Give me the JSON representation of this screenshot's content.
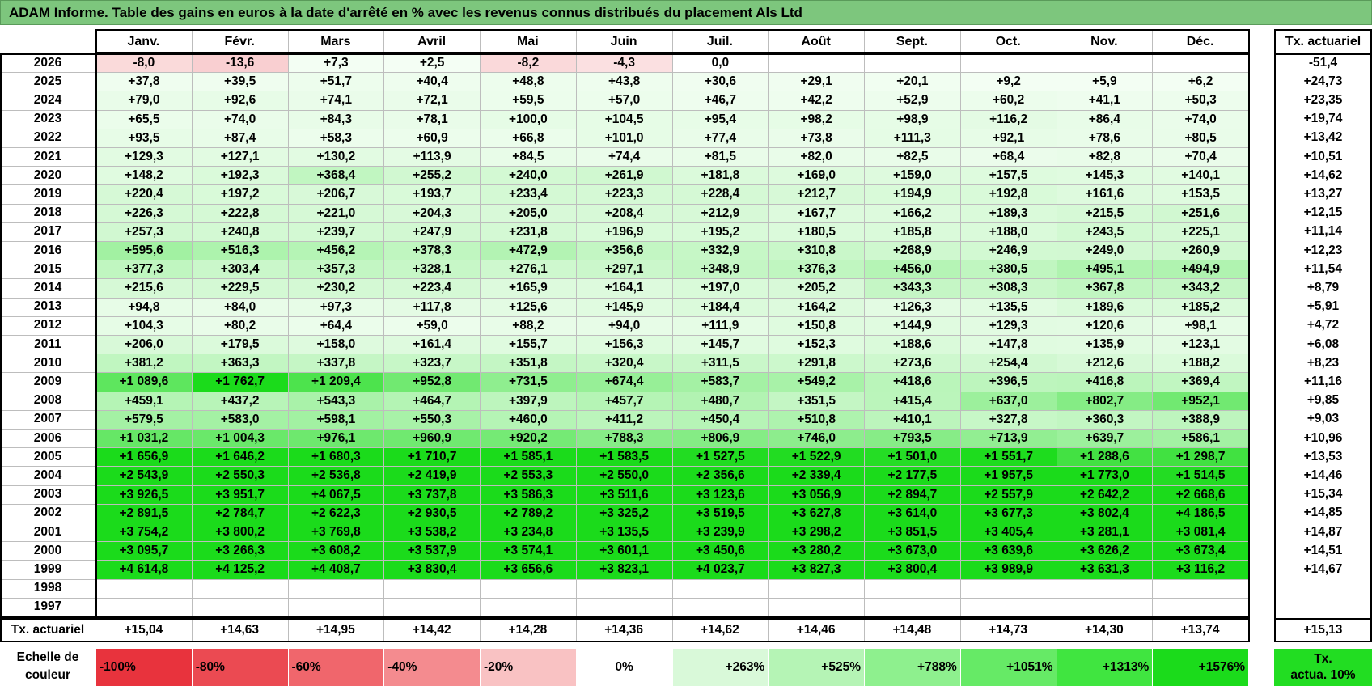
{
  "title": "ADAM Informe. Table des gains en euros à la date d'arrêté en % avec les revenus connus distribués du placement Als Ltd",
  "months": [
    "Janv.",
    "Févr.",
    "Mars",
    "Avril",
    "Mai",
    "Juin",
    "Juil.",
    "Août",
    "Sept.",
    "Oct.",
    "Nov.",
    "Déc."
  ],
  "tx_header": "Tx. actuariel",
  "rows": [
    {
      "year": "2026",
      "values": [
        "-8,0",
        "-13,6",
        "+7,3",
        "+2,5",
        "-8,2",
        "-4,3",
        "0,0",
        "",
        "",
        "",
        "",
        ""
      ],
      "tx": "-51,4"
    },
    {
      "year": "2025",
      "values": [
        "+37,8",
        "+39,5",
        "+51,7",
        "+40,4",
        "+48,8",
        "+43,8",
        "+30,6",
        "+29,1",
        "+20,1",
        "+9,2",
        "+5,9",
        "+6,2"
      ],
      "tx": "+24,73"
    },
    {
      "year": "2024",
      "values": [
        "+79,0",
        "+92,6",
        "+74,1",
        "+72,1",
        "+59,5",
        "+57,0",
        "+46,7",
        "+42,2",
        "+52,9",
        "+60,2",
        "+41,1",
        "+50,3"
      ],
      "tx": "+23,35"
    },
    {
      "year": "2023",
      "values": [
        "+65,5",
        "+74,0",
        "+84,3",
        "+78,1",
        "+100,0",
        "+104,5",
        "+95,4",
        "+98,2",
        "+98,9",
        "+116,2",
        "+86,4",
        "+74,0"
      ],
      "tx": "+19,74"
    },
    {
      "year": "2022",
      "values": [
        "+93,5",
        "+87,4",
        "+58,3",
        "+60,9",
        "+66,8",
        "+101,0",
        "+77,4",
        "+73,8",
        "+111,3",
        "+92,1",
        "+78,6",
        "+80,5"
      ],
      "tx": "+13,42"
    },
    {
      "year": "2021",
      "values": [
        "+129,3",
        "+127,1",
        "+130,2",
        "+113,9",
        "+84,5",
        "+74,4",
        "+81,5",
        "+82,0",
        "+82,5",
        "+68,4",
        "+82,8",
        "+70,4"
      ],
      "tx": "+10,51"
    },
    {
      "year": "2020",
      "values": [
        "+148,2",
        "+192,3",
        "+368,4",
        "+255,2",
        "+240,0",
        "+261,9",
        "+181,8",
        "+169,0",
        "+159,0",
        "+157,5",
        "+145,3",
        "+140,1"
      ],
      "tx": "+14,62"
    },
    {
      "year": "2019",
      "values": [
        "+220,4",
        "+197,2",
        "+206,7",
        "+193,7",
        "+233,4",
        "+223,3",
        "+228,4",
        "+212,7",
        "+194,9",
        "+192,8",
        "+161,6",
        "+153,5"
      ],
      "tx": "+13,27"
    },
    {
      "year": "2018",
      "values": [
        "+226,3",
        "+222,8",
        "+221,0",
        "+204,3",
        "+205,0",
        "+208,4",
        "+212,9",
        "+167,7",
        "+166,2",
        "+189,3",
        "+215,5",
        "+251,6"
      ],
      "tx": "+12,15"
    },
    {
      "year": "2017",
      "values": [
        "+257,3",
        "+240,8",
        "+239,7",
        "+247,9",
        "+231,8",
        "+196,9",
        "+195,2",
        "+180,5",
        "+185,8",
        "+188,0",
        "+243,5",
        "+225,1"
      ],
      "tx": "+11,14"
    },
    {
      "year": "2016",
      "values": [
        "+595,6",
        "+516,3",
        "+456,2",
        "+378,3",
        "+472,9",
        "+356,6",
        "+332,9",
        "+310,8",
        "+268,9",
        "+246,9",
        "+249,0",
        "+260,9"
      ],
      "tx": "+12,23"
    },
    {
      "year": "2015",
      "values": [
        "+377,3",
        "+303,4",
        "+357,3",
        "+328,1",
        "+276,1",
        "+297,1",
        "+348,9",
        "+376,3",
        "+456,0",
        "+380,5",
        "+495,1",
        "+494,9"
      ],
      "tx": "+11,54"
    },
    {
      "year": "2014",
      "values": [
        "+215,6",
        "+229,5",
        "+230,2",
        "+223,4",
        "+165,9",
        "+164,1",
        "+197,0",
        "+205,2",
        "+343,3",
        "+308,3",
        "+367,8",
        "+343,2"
      ],
      "tx": "+8,79"
    },
    {
      "year": "2013",
      "values": [
        "+94,8",
        "+84,0",
        "+97,3",
        "+117,8",
        "+125,6",
        "+145,9",
        "+184,4",
        "+164,2",
        "+126,3",
        "+135,5",
        "+189,6",
        "+185,2"
      ],
      "tx": "+5,91"
    },
    {
      "year": "2012",
      "values": [
        "+104,3",
        "+80,2",
        "+64,4",
        "+59,0",
        "+88,2",
        "+94,0",
        "+111,9",
        "+150,8",
        "+144,9",
        "+129,3",
        "+120,6",
        "+98,1"
      ],
      "tx": "+4,72"
    },
    {
      "year": "2011",
      "values": [
        "+206,0",
        "+179,5",
        "+158,0",
        "+161,4",
        "+155,7",
        "+156,3",
        "+145,7",
        "+152,3",
        "+188,6",
        "+147,8",
        "+135,9",
        "+123,1"
      ],
      "tx": "+6,08"
    },
    {
      "year": "2010",
      "values": [
        "+381,2",
        "+363,3",
        "+337,8",
        "+323,7",
        "+351,8",
        "+320,4",
        "+311,5",
        "+291,8",
        "+273,6",
        "+254,4",
        "+212,6",
        "+188,2"
      ],
      "tx": "+8,23"
    },
    {
      "year": "2009",
      "values": [
        "+1 089,6",
        "+1 762,7",
        "+1 209,4",
        "+952,8",
        "+731,5",
        "+674,4",
        "+583,7",
        "+549,2",
        "+418,6",
        "+396,5",
        "+416,8",
        "+369,4"
      ],
      "tx": "+11,16"
    },
    {
      "year": "2008",
      "values": [
        "+459,1",
        "+437,2",
        "+543,3",
        "+464,7",
        "+397,9",
        "+457,7",
        "+480,7",
        "+351,5",
        "+415,4",
        "+637,0",
        "+802,7",
        "+952,1"
      ],
      "tx": "+9,85"
    },
    {
      "year": "2007",
      "values": [
        "+579,5",
        "+583,0",
        "+598,1",
        "+550,3",
        "+460,0",
        "+411,2",
        "+450,4",
        "+510,8",
        "+410,1",
        "+327,8",
        "+360,3",
        "+388,9"
      ],
      "tx": "+9,03"
    },
    {
      "year": "2006",
      "values": [
        "+1 031,2",
        "+1 004,3",
        "+976,1",
        "+960,9",
        "+920,2",
        "+788,3",
        "+806,9",
        "+746,0",
        "+793,5",
        "+713,9",
        "+639,7",
        "+586,1"
      ],
      "tx": "+10,96"
    },
    {
      "year": "2005",
      "values": [
        "+1 656,9",
        "+1 646,2",
        "+1 680,3",
        "+1 710,7",
        "+1 585,1",
        "+1 583,5",
        "+1 527,5",
        "+1 522,9",
        "+1 501,0",
        "+1 551,7",
        "+1 288,6",
        "+1 298,7"
      ],
      "tx": "+13,53"
    },
    {
      "year": "2004",
      "values": [
        "+2 543,9",
        "+2 550,3",
        "+2 536,8",
        "+2 419,9",
        "+2 553,3",
        "+2 550,0",
        "+2 356,6",
        "+2 339,4",
        "+2 177,5",
        "+1 957,5",
        "+1 773,0",
        "+1 514,5"
      ],
      "tx": "+14,46"
    },
    {
      "year": "2003",
      "values": [
        "+3 926,5",
        "+3 951,7",
        "+4 067,5",
        "+3 737,8",
        "+3 586,3",
        "+3 511,6",
        "+3 123,6",
        "+3 056,9",
        "+2 894,7",
        "+2 557,9",
        "+2 642,2",
        "+2 668,6"
      ],
      "tx": "+15,34"
    },
    {
      "year": "2002",
      "values": [
        "+2 891,5",
        "+2 784,7",
        "+2 622,3",
        "+2 930,5",
        "+2 789,2",
        "+3 325,2",
        "+3 519,5",
        "+3 627,8",
        "+3 614,0",
        "+3 677,3",
        "+3 802,4",
        "+4 186,5"
      ],
      "tx": "+14,85"
    },
    {
      "year": "2001",
      "values": [
        "+3 754,2",
        "+3 800,2",
        "+3 769,8",
        "+3 538,2",
        "+3 234,8",
        "+3 135,5",
        "+3 239,9",
        "+3 298,2",
        "+3 851,5",
        "+3 405,4",
        "+3 281,1",
        "+3 081,4"
      ],
      "tx": "+14,87"
    },
    {
      "year": "2000",
      "values": [
        "+3 095,7",
        "+3 266,3",
        "+3 608,2",
        "+3 537,9",
        "+3 574,1",
        "+3 601,1",
        "+3 450,6",
        "+3 280,2",
        "+3 673,0",
        "+3 639,6",
        "+3 626,2",
        "+3 673,4"
      ],
      "tx": "+14,51"
    },
    {
      "year": "1999",
      "values": [
        "+4 614,8",
        "+4 125,2",
        "+4 408,7",
        "+3 830,4",
        "+3 656,6",
        "+3 823,1",
        "+4 023,7",
        "+3 827,3",
        "+3 800,4",
        "+3 989,9",
        "+3 631,3",
        "+3 116,2"
      ],
      "tx": "+14,67"
    },
    {
      "year": "1998",
      "values": [
        "",
        "",
        "",
        "",
        "",
        "",
        "",
        "",
        "",
        "",
        "",
        ""
      ],
      "tx": ""
    },
    {
      "year": "1997",
      "values": [
        "",
        "",
        "",
        "",
        "",
        "",
        "",
        "",
        "",
        "",
        "",
        ""
      ],
      "tx": ""
    }
  ],
  "footer": {
    "label": "Tx. actuariel",
    "values": [
      "+15,04",
      "+14,63",
      "+14,95",
      "+14,42",
      "+14,28",
      "+14,36",
      "+14,62",
      "+14,46",
      "+14,48",
      "+14,73",
      "+14,30",
      "+13,74"
    ],
    "tx": "+15,13"
  },
  "legend": {
    "label_line1": "Echelle de",
    "label_line2": "couleur",
    "items": [
      {
        "text": "-100%",
        "align": "left",
        "color": "#e8333d"
      },
      {
        "text": "-80%",
        "align": "left",
        "color": "#eb4a52"
      },
      {
        "text": "-60%",
        "align": "left",
        "color": "#f0666c"
      },
      {
        "text": "-40%",
        "align": "left",
        "color": "#f48b8f"
      },
      {
        "text": "-20%",
        "align": "left",
        "color": "#f9c2c3"
      },
      {
        "text": "0%",
        "align": "center",
        "color": "#ffffff"
      },
      {
        "text": "+263%",
        "align": "right",
        "color": "#d9f9d9"
      },
      {
        "text": "+525%",
        "align": "right",
        "color": "#b5f4b5"
      },
      {
        "text": "+788%",
        "align": "right",
        "color": "#8ef08e"
      },
      {
        "text": "+1051%",
        "align": "right",
        "color": "#66ea66"
      },
      {
        "text": "+1313%",
        "align": "right",
        "color": "#40e540"
      },
      {
        "text": "+1576%",
        "align": "right",
        "color": "#1bdb1b"
      }
    ],
    "tx_line1": "Tx.",
    "tx_line2": "actua. 10%",
    "tx_color": "#22dd22"
  },
  "chart_data": {
    "type": "heatmap",
    "title": "ADAM Informe. Table des gains en euros à la date d'arrêté en % avec les revenus connus distribués du placement Als Ltd",
    "x": [
      "Janv.",
      "Févr.",
      "Mars",
      "Avril",
      "Mai",
      "Juin",
      "Juil.",
      "Août",
      "Sept.",
      "Oct.",
      "Nov.",
      "Déc."
    ],
    "y": [
      "2026",
      "2025",
      "2024",
      "2023",
      "2022",
      "2021",
      "2020",
      "2019",
      "2018",
      "2017",
      "2016",
      "2015",
      "2014",
      "2013",
      "2012",
      "2011",
      "2010",
      "2009",
      "2008",
      "2007",
      "2006",
      "2005",
      "2004",
      "2003",
      "2002",
      "2001",
      "2000",
      "1999",
      "1998",
      "1997"
    ],
    "values": [
      [
        -8.0,
        -13.6,
        7.3,
        2.5,
        -8.2,
        -4.3,
        0.0,
        null,
        null,
        null,
        null,
        null
      ],
      [
        37.8,
        39.5,
        51.7,
        40.4,
        48.8,
        43.8,
        30.6,
        29.1,
        20.1,
        9.2,
        5.9,
        6.2
      ],
      [
        79.0,
        92.6,
        74.1,
        72.1,
        59.5,
        57.0,
        46.7,
        42.2,
        52.9,
        60.2,
        41.1,
        50.3
      ],
      [
        65.5,
        74.0,
        84.3,
        78.1,
        100.0,
        104.5,
        95.4,
        98.2,
        98.9,
        116.2,
        86.4,
        74.0
      ],
      [
        93.5,
        87.4,
        58.3,
        60.9,
        66.8,
        101.0,
        77.4,
        73.8,
        111.3,
        92.1,
        78.6,
        80.5
      ],
      [
        129.3,
        127.1,
        130.2,
        113.9,
        84.5,
        74.4,
        81.5,
        82.0,
        82.5,
        68.4,
        82.8,
        70.4
      ],
      [
        148.2,
        192.3,
        368.4,
        255.2,
        240.0,
        261.9,
        181.8,
        169.0,
        159.0,
        157.5,
        145.3,
        140.1
      ],
      [
        220.4,
        197.2,
        206.7,
        193.7,
        233.4,
        223.3,
        228.4,
        212.7,
        194.9,
        192.8,
        161.6,
        153.5
      ],
      [
        226.3,
        222.8,
        221.0,
        204.3,
        205.0,
        208.4,
        212.9,
        167.7,
        166.2,
        189.3,
        215.5,
        251.6
      ],
      [
        257.3,
        240.8,
        239.7,
        247.9,
        231.8,
        196.9,
        195.2,
        180.5,
        185.8,
        188.0,
        243.5,
        225.1
      ],
      [
        595.6,
        516.3,
        456.2,
        378.3,
        472.9,
        356.6,
        332.9,
        310.8,
        268.9,
        246.9,
        249.0,
        260.9
      ],
      [
        377.3,
        303.4,
        357.3,
        328.1,
        276.1,
        297.1,
        348.9,
        376.3,
        456.0,
        380.5,
        495.1,
        494.9
      ],
      [
        215.6,
        229.5,
        230.2,
        223.4,
        165.9,
        164.1,
        197.0,
        205.2,
        343.3,
        308.3,
        367.8,
        343.2
      ],
      [
        94.8,
        84.0,
        97.3,
        117.8,
        125.6,
        145.9,
        184.4,
        164.2,
        126.3,
        135.5,
        189.6,
        185.2
      ],
      [
        104.3,
        80.2,
        64.4,
        59.0,
        88.2,
        94.0,
        111.9,
        150.8,
        144.9,
        129.3,
        120.6,
        98.1
      ],
      [
        206.0,
        179.5,
        158.0,
        161.4,
        155.7,
        156.3,
        145.7,
        152.3,
        188.6,
        147.8,
        135.9,
        123.1
      ],
      [
        381.2,
        363.3,
        337.8,
        323.7,
        351.8,
        320.4,
        311.5,
        291.8,
        273.6,
        254.4,
        212.6,
        188.2
      ],
      [
        1089.6,
        1762.7,
        1209.4,
        952.8,
        731.5,
        674.4,
        583.7,
        549.2,
        418.6,
        396.5,
        416.8,
        369.4
      ],
      [
        459.1,
        437.2,
        543.3,
        464.7,
        397.9,
        457.7,
        480.7,
        351.5,
        415.4,
        637.0,
        802.7,
        952.1
      ],
      [
        579.5,
        583.0,
        598.1,
        550.3,
        460.0,
        411.2,
        450.4,
        510.8,
        410.1,
        327.8,
        360.3,
        388.9
      ],
      [
        1031.2,
        1004.3,
        976.1,
        960.9,
        920.2,
        788.3,
        806.9,
        746.0,
        793.5,
        713.9,
        639.7,
        586.1
      ],
      [
        1656.9,
        1646.2,
        1680.3,
        1710.7,
        1585.1,
        1583.5,
        1527.5,
        1522.9,
        1501.0,
        1551.7,
        1288.6,
        1298.7
      ],
      [
        2543.9,
        2550.3,
        2536.8,
        2419.9,
        2553.3,
        2550.0,
        2356.6,
        2339.4,
        2177.5,
        1957.5,
        1773.0,
        1514.5
      ],
      [
        3926.5,
        3951.7,
        4067.5,
        3737.8,
        3586.3,
        3511.6,
        3123.6,
        3056.9,
        2894.7,
        2557.9,
        2642.2,
        2668.6
      ],
      [
        2891.5,
        2784.7,
        2622.3,
        2930.5,
        2789.2,
        3325.2,
        3519.5,
        3627.8,
        3614.0,
        3677.3,
        3802.4,
        4186.5
      ],
      [
        3754.2,
        3800.2,
        3769.8,
        3538.2,
        3234.8,
        3135.5,
        3239.9,
        3298.2,
        3851.5,
        3405.4,
        3281.1,
        3081.4
      ],
      [
        3095.7,
        3266.3,
        3608.2,
        3537.9,
        3574.1,
        3601.1,
        3450.6,
        3280.2,
        3673.0,
        3639.6,
        3626.2,
        3673.4
      ],
      [
        4614.8,
        4125.2,
        4408.7,
        3830.4,
        3656.6,
        3823.1,
        4023.7,
        3827.3,
        3800.4,
        3989.9,
        3631.3,
        3116.2
      ],
      [
        null,
        null,
        null,
        null,
        null,
        null,
        null,
        null,
        null,
        null,
        null,
        null
      ],
      [
        null,
        null,
        null,
        null,
        null,
        null,
        null,
        null,
        null,
        null,
        null,
        null
      ]
    ],
    "row_totals_label": "Tx. actuariel",
    "row_totals": [
      -51.4,
      24.73,
      23.35,
      19.74,
      13.42,
      10.51,
      14.62,
      13.27,
      12.15,
      11.14,
      12.23,
      11.54,
      8.79,
      5.91,
      4.72,
      6.08,
      8.23,
      11.16,
      9.85,
      9.03,
      10.96,
      13.53,
      14.46,
      15.34,
      14.85,
      14.87,
      14.51,
      14.67,
      null,
      null
    ],
    "col_totals": [
      15.04,
      14.63,
      14.95,
      14.42,
      14.28,
      14.36,
      14.62,
      14.46,
      14.48,
      14.73,
      14.3,
      13.74
    ],
    "grand_total": 15.13,
    "color_scale": [
      {
        "value": -100,
        "color": "#e8333d"
      },
      {
        "value": -80,
        "color": "#eb4a52"
      },
      {
        "value": -60,
        "color": "#f0666c"
      },
      {
        "value": -40,
        "color": "#f48b8f"
      },
      {
        "value": -20,
        "color": "#f9c2c3"
      },
      {
        "value": 0,
        "color": "#ffffff"
      },
      {
        "value": 263,
        "color": "#d9f9d9"
      },
      {
        "value": 525,
        "color": "#b5f4b5"
      },
      {
        "value": 788,
        "color": "#8ef08e"
      },
      {
        "value": 1051,
        "color": "#66ea66"
      },
      {
        "value": 1313,
        "color": "#40e540"
      },
      {
        "value": 1576,
        "color": "#1bdb1b"
      }
    ]
  }
}
